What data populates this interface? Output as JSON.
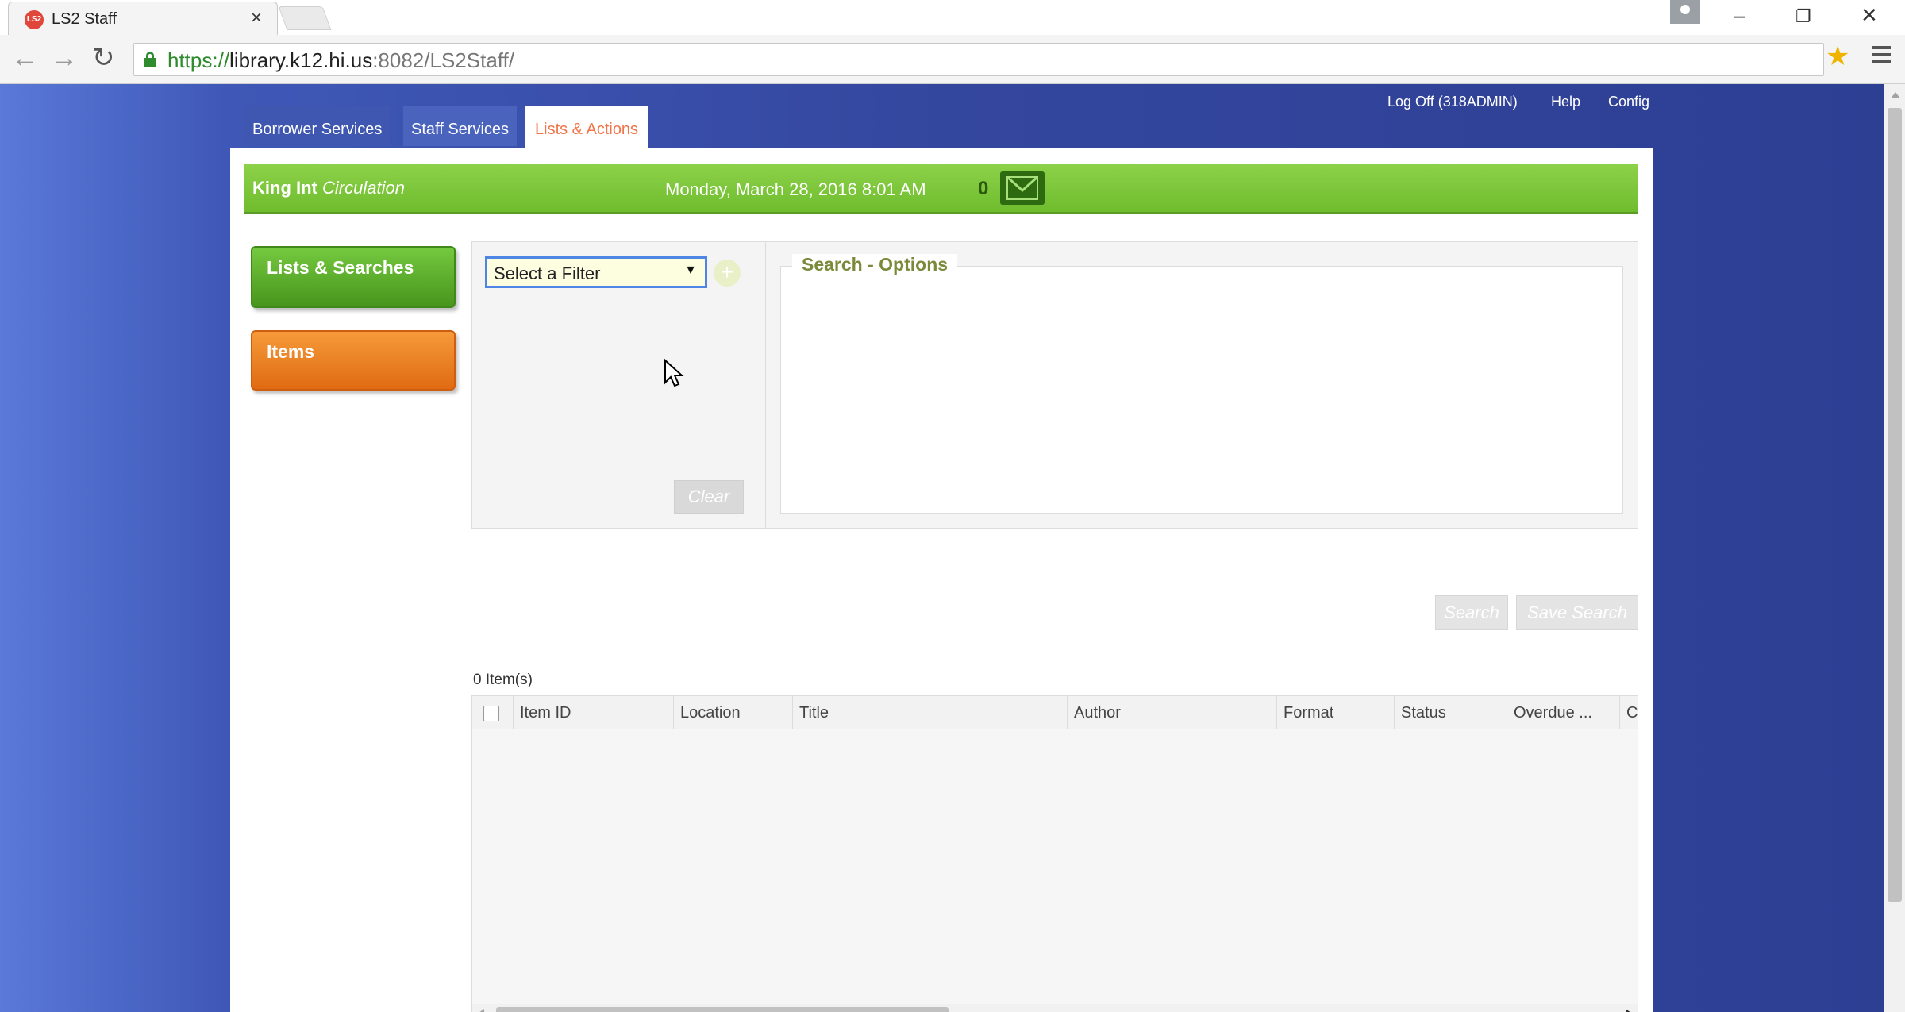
{
  "browser": {
    "tab_title": "LS2 Staff",
    "favicon_text": "LS2",
    "url_scheme": "https://",
    "url_host": "library.k12.hi.us",
    "url_rest": ":8082/LS2Staff/"
  },
  "top_links": {
    "logoff": "Log Off (318ADMIN)",
    "help": "Help",
    "config": "Config"
  },
  "main_tabs": [
    {
      "label": "Borrower Services"
    },
    {
      "label": "Staff Services"
    },
    {
      "label": "Lists & Actions",
      "active": true
    }
  ],
  "status_bar": {
    "branch": "King Int",
    "module": "Circulation",
    "datetime": "Monday, March 28, 2016 8:01 AM",
    "message_count": "0"
  },
  "sidebar": {
    "lists_label": "Lists & Searches",
    "items_label": "Items"
  },
  "filter": {
    "select_value": "Select a Filter",
    "clear_label": "Clear",
    "options_title": "Search - Options"
  },
  "actions": {
    "search_label": "Search",
    "save_search_label": "Save Search"
  },
  "results": {
    "count_text": "0 Item(s)",
    "columns": [
      "Item ID",
      "Location",
      "Title",
      "Author",
      "Format",
      "Status",
      "Overdue ...",
      "C"
    ]
  },
  "colors": {
    "accent_green": "#6fbc2e",
    "accent_orange": "#e06a12",
    "active_tab_text": "#f0754a",
    "page_background": "#34479f"
  },
  "icons": {
    "mail": "envelope-icon",
    "add_filter": "plus-circle-icon",
    "lock": "lock-icon",
    "bookmark": "star-icon",
    "menu": "hamburger-menu-icon"
  }
}
